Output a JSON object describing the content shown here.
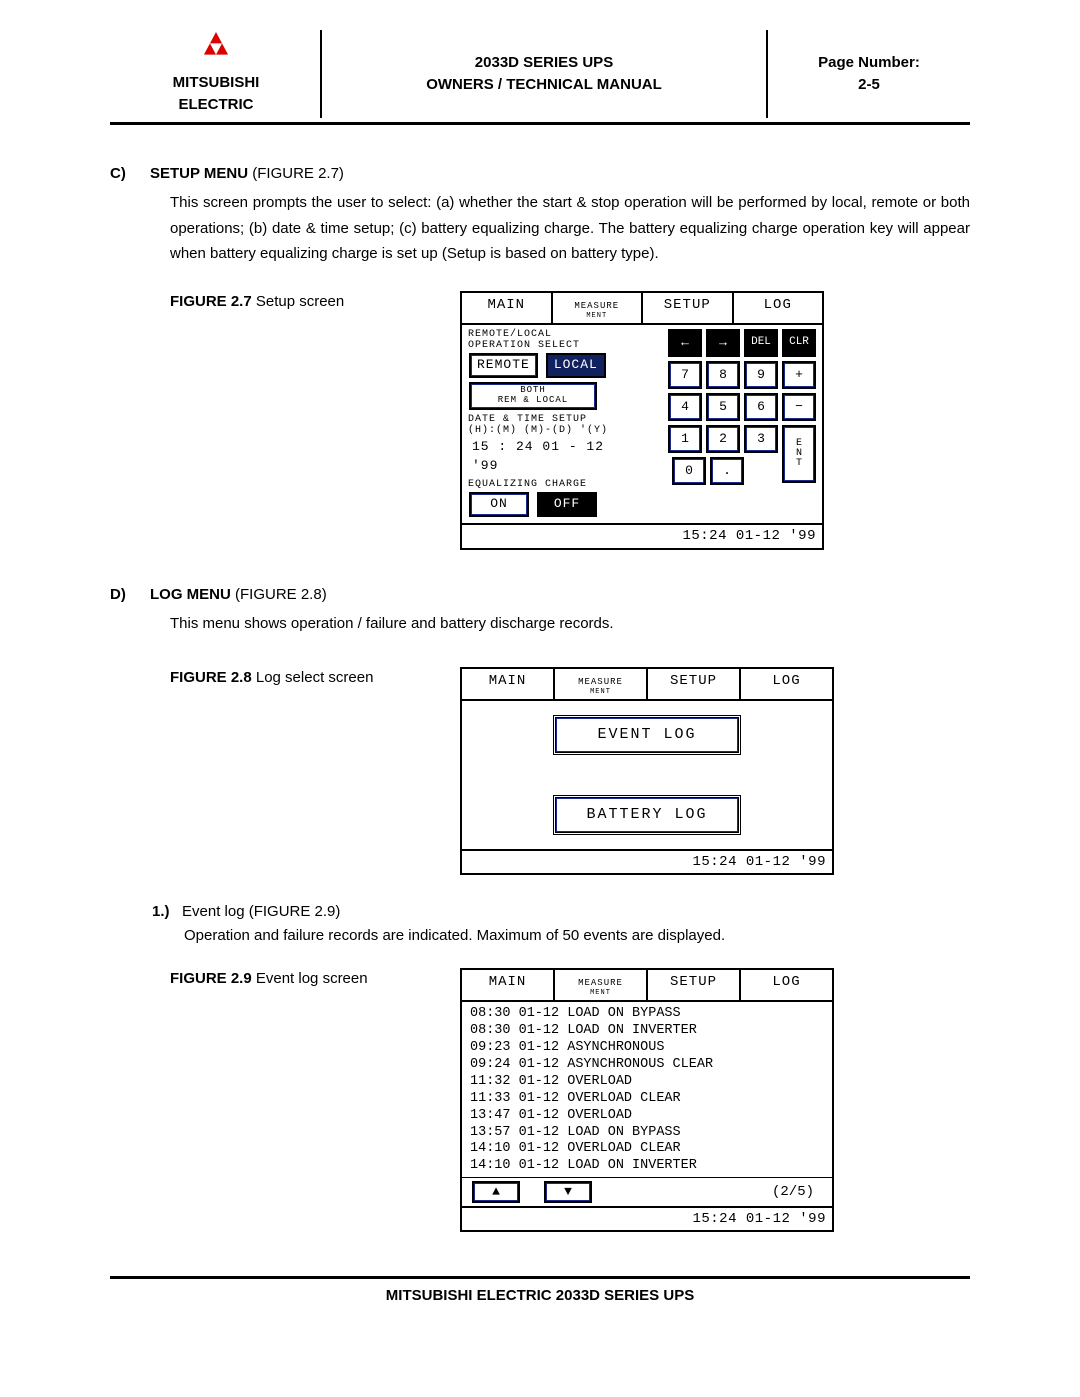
{
  "header": {
    "brand_top": "MITSUBISHI",
    "brand_bot": "ELECTRIC",
    "title_top": "2033D SERIES UPS",
    "title_bot": "OWNERS / TECHNICAL MANUAL",
    "page_label": "Page Number:",
    "page_num": "2-5"
  },
  "sectionC": {
    "letter": "C)",
    "title_bold": "SETUP MENU",
    "title_paren": " (FIGURE 2.7)",
    "body": "This screen prompts the user to select: (a) whether the start & stop operation will be performed by local, remote or both operations; (b) date & time setup; (c) battery equalizing charge. The battery equalizing charge operation key will appear when battery equalizing charge is set up (Setup is based on battery type)."
  },
  "fig27": {
    "label_bold": "FIGURE 2.7",
    "label_rest": "   Setup   screen",
    "tabs": [
      "MAIN",
      "MEASURE",
      "SETUP",
      "LOG"
    ],
    "tab_ment": "MENT",
    "remote_local_hdr1": "REMOTE/LOCAL",
    "remote_local_hdr2": "OPERATION SELECT",
    "btn_remote": "REMOTE",
    "btn_local": "LOCAL",
    "btn_both1": "BOTH",
    "btn_both2": "REM  &  LOCAL",
    "datetime_hdr": "DATE & TIME SETUP",
    "datetime_fmt": "(H):(M) (M)-(D)   '(Y)",
    "datetime_val": "15 : 24   01 - 12    '99",
    "eq_hdr": "EQUALIZING CHARGE",
    "btn_on": "ON",
    "btn_off": "OFF",
    "keypad": {
      "row1": [
        "←",
        "→",
        "DEL",
        "CLR"
      ],
      "row2": [
        "7",
        "8",
        "9",
        "+"
      ],
      "row3": [
        "4",
        "5",
        "6",
        "−"
      ],
      "row4": [
        "1",
        "2",
        "3"
      ],
      "row5": [
        "0",
        "."
      ],
      "ent": "E\nN\nT"
    },
    "footer": "15:24 01-12 '99"
  },
  "sectionD": {
    "letter": "D)",
    "title_bold": "LOG MENU",
    "title_paren": " (FIGURE 2.8)",
    "body": "This menu shows operation / failure and battery discharge records."
  },
  "fig28": {
    "label_bold": "FIGURE 2.8",
    "label_rest": "   Log select screen",
    "tabs": [
      "MAIN",
      "MEASURE",
      "SETUP",
      "LOG"
    ],
    "btn_event": "EVENT LOG",
    "btn_batt": "BATTERY LOG",
    "footer": "15:24 01-12 '99"
  },
  "sub1": {
    "num": "1.)",
    "text": "Event log (FIGURE 2.9)",
    "body": "Operation and failure records are indicated. Maximum of 50 events are displayed."
  },
  "fig29": {
    "label_bold": "FIGURE 2.9",
    "label_rest": "   Event log screen",
    "tabs": [
      "MAIN",
      "MEASURE",
      "SETUP",
      "LOG"
    ],
    "events": [
      "08:30 01-12 LOAD ON BYPASS",
      "08:30 01-12 LOAD ON INVERTER",
      "09:23 01-12 ASYNCHRONOUS",
      "09:24 01-12 ASYNCHRONOUS CLEAR",
      "11:32 01-12 OVERLOAD",
      "11:33 01-12 OVERLOAD CLEAR",
      "13:47 01-12 OVERLOAD",
      "13:57 01-12 LOAD ON BYPASS",
      "14:10 01-12 OVERLOAD CLEAR",
      "14:10 01-12 LOAD ON INVERTER"
    ],
    "arrow_up": "▲",
    "arrow_dn": "▼",
    "page": "(2/5)",
    "footer": "15:24 01-12 '99"
  },
  "footer_text": "MITSUBISHI ELECTRIC 2033D SERIES UPS"
}
